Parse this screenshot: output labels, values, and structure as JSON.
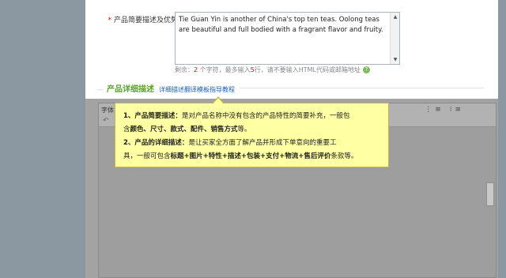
{
  "form": {
    "brief_label": "产品简要描述及优势",
    "required_mark": "*",
    "brief_value": "Tie Guan Yin is another of China's top ten teas.  Oolong teas are beautiful and full bodied with a fragrant flavor and fruity.",
    "hint_prefix": "剩余：",
    "hint_remaining": "2",
    "hint_mid": " 个字符，最多输入",
    "hint_max": "5",
    "hint_suffix": "行，请不要输入HTML代码或邮箱地址",
    "help_icon": "?"
  },
  "section": {
    "dash": "—",
    "title": "产品详细描述",
    "link": "详细描述翻译模板指导教程"
  },
  "editor": {
    "font_label": "字体",
    "toolbar_icons": "⋮≡ ⁝≡",
    "undo_icon": "↶"
  },
  "tooltip": {
    "line1_num": "1、",
    "line1_bold": "产品简要描述：",
    "line1_text": "是对产品名称中没有包含的产品特性的简要补充，一般包",
    "line2_pre": "含",
    "line2_bold": "颜色、尺寸、款式、配件、销售方式",
    "line2_post": "等。",
    "line3_num": "2、",
    "line3_bold": "产品的详细描述：",
    "line3_text": "是让买家全方面了解产品并形成下单意向的重要工",
    "line4_pre": "具，一般可包含",
    "line4_bold": "标题+图片+特性+描述+包装+支付+物流+售后评价",
    "line4_post": "条款等。"
  },
  "colors": {
    "overlay": "#8b98a2",
    "tooltip_bg": "#ffffa3",
    "section_title": "#58a324",
    "link": "#1a5fb4",
    "required": "#ee0000"
  }
}
